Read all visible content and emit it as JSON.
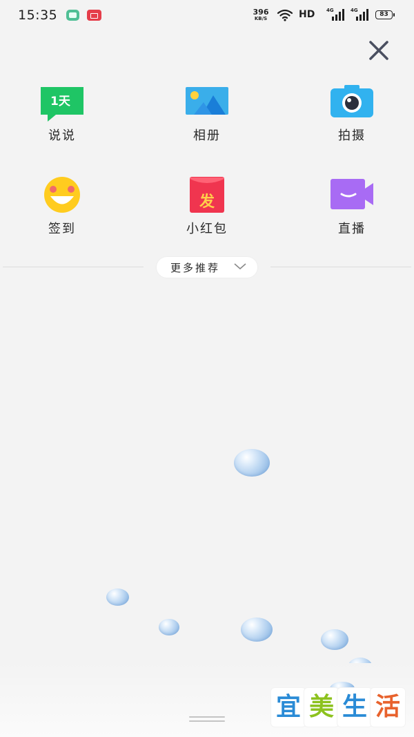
{
  "status_bar": {
    "time": "15:35",
    "net_speed_value": "396",
    "net_speed_unit": "KB/S",
    "hd_label": "HD",
    "signal_1_label": "4G",
    "signal_2_label": "4G",
    "battery_level": "83"
  },
  "grid": {
    "items": [
      {
        "label": "说说",
        "icon": "talk-bubble-icon",
        "badge": "1天"
      },
      {
        "label": "相册",
        "icon": "photo-album-icon"
      },
      {
        "label": "拍摄",
        "icon": "camera-icon"
      },
      {
        "label": "签到",
        "icon": "smiley-face-icon"
      },
      {
        "label": "小红包",
        "icon": "red-packet-icon",
        "badge": "发"
      },
      {
        "label": "直播",
        "icon": "live-video-icon"
      }
    ]
  },
  "more": {
    "label": "更多推荐"
  },
  "watermark": {
    "text": "宜美生活"
  },
  "colors": {
    "background": "#f3f3f3",
    "green": "#1fc565",
    "sky_blue": "#3aaeea",
    "camera_blue": "#31b2ef",
    "smiley_yellow": "#ffcc1f",
    "red_packet": "#f0354f",
    "live_purple": "#a86bf4"
  }
}
